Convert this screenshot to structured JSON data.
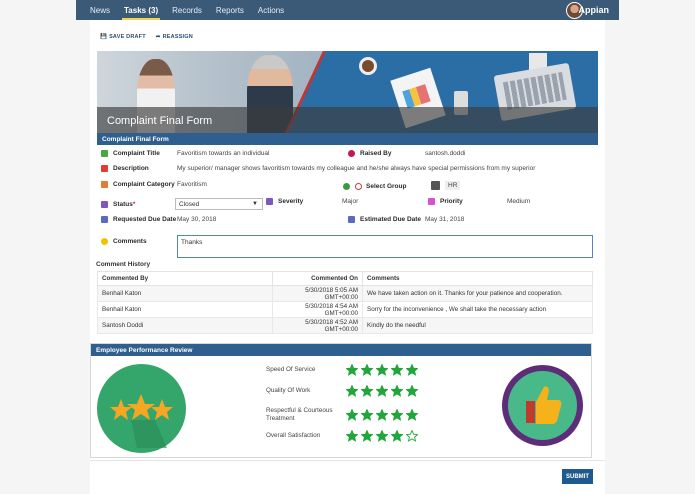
{
  "nav": {
    "tabs": [
      {
        "label": "News"
      },
      {
        "label": "Tasks (3)"
      },
      {
        "label": "Records"
      },
      {
        "label": "Reports"
      },
      {
        "label": "Actions"
      }
    ],
    "brand": "Appian"
  },
  "toolbar": {
    "save_draft": "SAVE DRAFT",
    "reassign": "REASSIGN"
  },
  "banner": {
    "title": "Complaint Final Form"
  },
  "form": {
    "section_title": "Complaint Final Form",
    "complaint_title_label": "Complaint Title",
    "complaint_title_value": "Favoritism towards an individual",
    "raised_by_label": "Raised By",
    "raised_by_value": "santosh.doddi",
    "description_label": "Description",
    "description_value": "My superior/ manager shows favoritism towards my colleague and he/she always have special permissions from my superior",
    "category_label": "Complaint Category",
    "category_value": "Favoritism",
    "select_group_label": "Select Group",
    "select_group_value": "HR",
    "status_label": "Status",
    "status_required": "*",
    "status_value": "Closed",
    "severity_label": "Severity",
    "severity_value": "Major",
    "priority_label": "Priority",
    "priority_value": "Medium",
    "requested_due_label": "Requested Due Date",
    "requested_due_value": "May 30, 2018",
    "estimated_due_label": "Estimated Due Date",
    "estimated_due_value": "May 31, 2018",
    "comments_label": "Comments",
    "comments_value": "Thanks"
  },
  "history": {
    "title": "Comment History",
    "headers": {
      "by": "Commented By",
      "on": "Commented On",
      "comments": "Comments"
    },
    "rows": [
      {
        "by": "Benhail Katon",
        "on": "5/30/2018 5:05 AM GMT+00:00",
        "comment": "We have taken action on it. Thanks for your patience and cooperation."
      },
      {
        "by": "Benhail Katon",
        "on": "5/30/2018 4:54 AM GMT+00:00",
        "comment": "Sorry for the inconvenience , We shall take the necessary action"
      },
      {
        "by": "Santosh Doddi",
        "on": "5/30/2018 4:52 AM GMT+00:00",
        "comment": "Kindly do the needful"
      }
    ]
  },
  "review": {
    "title": "Employee Performance Review",
    "items": [
      {
        "label": "Speed Of Service",
        "stars": 5
      },
      {
        "label": "Quality Of Work",
        "stars": 5
      },
      {
        "label": "Respectful & Courteous Treatment",
        "stars": 5
      },
      {
        "label": "Overall Satisfaction",
        "stars": 4
      }
    ],
    "max_stars": 5
  },
  "submit_label": "SUBMIT",
  "colors": {
    "nav": "#3a5a78",
    "section": "#2f5f8f",
    "star": "#22a63c",
    "submit": "#1e5a8e"
  }
}
